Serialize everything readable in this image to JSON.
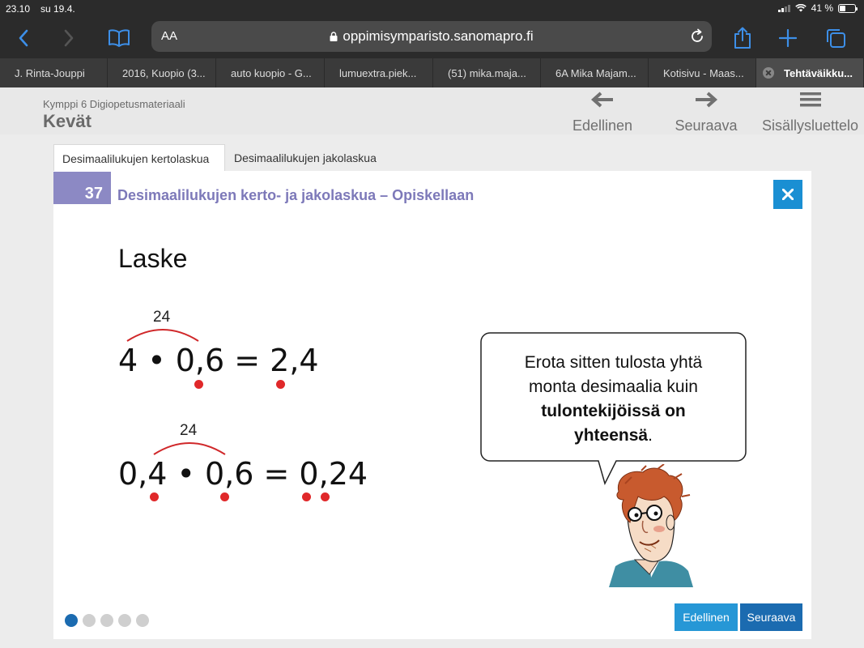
{
  "status": {
    "time": "23.10",
    "date": "su 19.4.",
    "battery": "41 %",
    "battery_level": 0.41
  },
  "browser": {
    "url": "oppimisymparisto.sanomapro.fi",
    "aa": "AA",
    "icons": {
      "back": "chevron-left-icon",
      "forward": "chevron-right-icon",
      "bookmarks": "book-icon",
      "lock": "lock-icon",
      "reload": "reload-icon",
      "share": "share-icon",
      "new_tab": "plus-icon",
      "tabs": "tabs-icon"
    },
    "tabs": [
      {
        "label": "J. Rinta-Jouppi"
      },
      {
        "label": "2016, Kuopio (3..."
      },
      {
        "label": "auto kuopio - G..."
      },
      {
        "label": "lumuextra.piek..."
      },
      {
        "label": "(51) mika.maja..."
      },
      {
        "label": "6A Mika Majam..."
      },
      {
        "label": "Kotisivu - Maas..."
      },
      {
        "label": "Tehtäväikku...",
        "active": true
      }
    ]
  },
  "app": {
    "subtitle": "Kymppi 6 Digiopetusmateriaali",
    "title": "Kevät",
    "nav": {
      "prev": "Edellinen",
      "next": "Seuraava",
      "toc": "Sisällysluettelo"
    }
  },
  "page_tabs": [
    "Desimaalilukujen kertolaskua",
    "Desimaalilukujen jakolaskua"
  ],
  "card": {
    "number": "37",
    "heading": "Desimaalilukujen kerto- ja jakolaskua – Opiskellaan",
    "laske": "Laske",
    "eq1": {
      "annotation": "24",
      "expr": "4 • 0,6 = 2,4"
    },
    "eq2": {
      "annotation": "24",
      "expr": "0,4 • 0,6 = 0,24"
    },
    "bubble": {
      "line1": "Erota sitten tulosta yhtä",
      "line2": "monta desimaalia kuin",
      "bold1": "tulontekijöissä on",
      "bold2": "yhteensä",
      "end": "."
    },
    "pager": {
      "pages": 5,
      "current": 1
    },
    "buttons": {
      "prev": "Edellinen",
      "next": "Seuraava"
    }
  },
  "colors": {
    "accent": "#8c89c4",
    "heading": "#7d79b9",
    "close": "#1a8fd3",
    "dot": "#e0282a",
    "next": "#1b6bb0",
    "prev": "#2697d6"
  }
}
